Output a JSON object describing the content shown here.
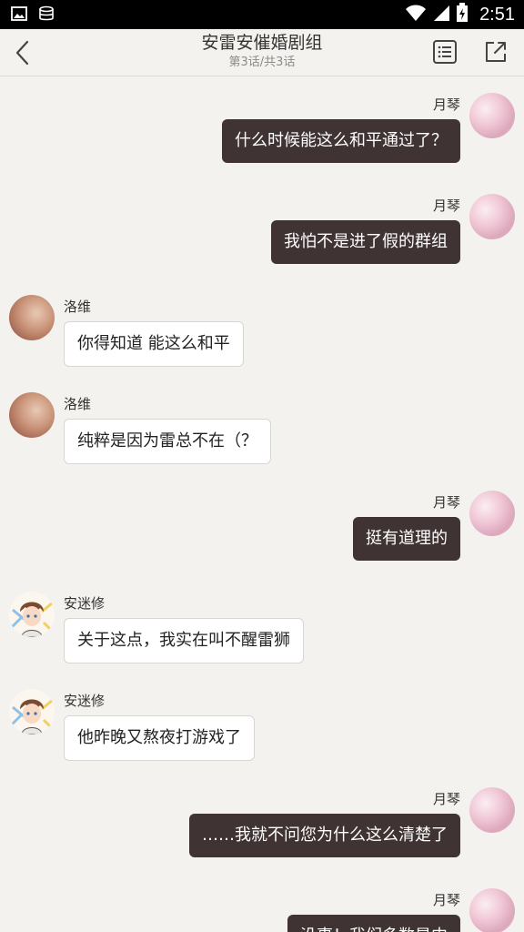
{
  "status_bar": {
    "time": "2:51"
  },
  "header": {
    "title": "安雷安催婚剧组",
    "subtitle": "第3话/共3话"
  },
  "messages": [
    {
      "side": "right",
      "name": "月琴",
      "text": "什么时候能这么和平通过了？",
      "avatar": "pink"
    },
    {
      "side": "right",
      "name": "月琴",
      "text": "我怕不是进了假的群组",
      "avatar": "pink"
    },
    {
      "side": "left",
      "name": "洛维",
      "text": "你得知道 能这么和平",
      "avatar": "brown"
    },
    {
      "side": "left",
      "name": "洛维",
      "text": "纯粹是因为雷总不在（？",
      "avatar": "brown"
    },
    {
      "side": "right",
      "name": "月琴",
      "text": "挺有道理的",
      "avatar": "pink"
    },
    {
      "side": "left",
      "name": "安迷修",
      "text": "关于这点，我实在叫不醒雷狮",
      "avatar": "boy"
    },
    {
      "side": "left",
      "name": "安迷修",
      "text": "他昨晚又熬夜打游戏了",
      "avatar": "boy"
    },
    {
      "side": "right",
      "name": "月琴",
      "text": "……我就不问您为什么这么清楚了",
      "avatar": "pink"
    },
    {
      "side": "right",
      "name": "月琴",
      "text": "没事！我们多数是中",
      "avatar": "pink"
    }
  ]
}
